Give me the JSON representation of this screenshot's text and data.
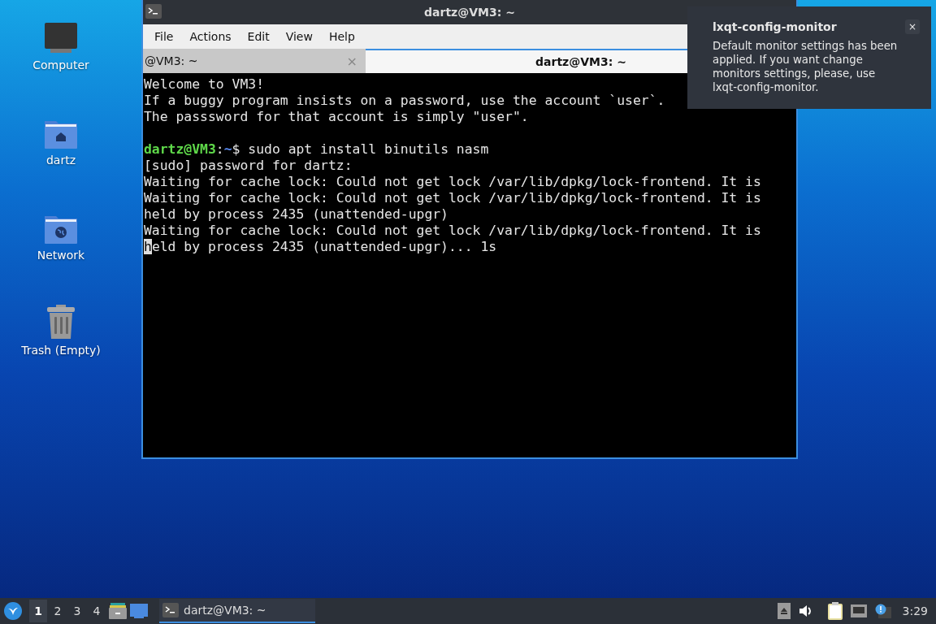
{
  "desktop_icons": [
    {
      "kind": "computer",
      "label": "Computer"
    },
    {
      "kind": "home",
      "label": "dartz"
    },
    {
      "kind": "network",
      "label": "Network"
    },
    {
      "kind": "trash",
      "label": "Trash (Empty)"
    }
  ],
  "window": {
    "title": "dartz@VM3: ~",
    "menu": [
      "File",
      "Actions",
      "Edit",
      "View",
      "Help"
    ],
    "tabs": [
      {
        "label": "@VM3: ~",
        "selected": false,
        "close": "×"
      },
      {
        "label": "dartz@VM3: ~",
        "selected": true
      }
    ],
    "lines": [
      {
        "kind": "output",
        "text": "Welcome to VM3!"
      },
      {
        "kind": "output",
        "text": "If a buggy program insists on a password, use the account `user`."
      },
      {
        "kind": "output",
        "text": "The passsword for that account is simply \"user\"."
      },
      {
        "kind": "blank"
      },
      {
        "kind": "prompt",
        "user": "dartz@VM3",
        "sep": ":",
        "path": "~",
        "command": "$ sudo apt install binutils nasm"
      },
      {
        "kind": "output",
        "text": "[sudo] password for dartz:"
      },
      {
        "kind": "output",
        "text": "Waiting for cache lock: Could not get lock /var/lib/dpkg/lock-frontend. It is"
      },
      {
        "kind": "output",
        "text": "Waiting for cache lock: Could not get lock /var/lib/dpkg/lock-frontend. It is"
      },
      {
        "kind": "output",
        "text": "held by process 2435 (unattended-upgr)"
      },
      {
        "kind": "output",
        "text": "Waiting for cache lock: Could not get lock /var/lib/dpkg/lock-frontend. It is"
      },
      {
        "kind": "cursor",
        "cursor": "h",
        "text": "eld by process 2435 (unattended-upgr)... 1s"
      }
    ]
  },
  "notification": {
    "title": "lxqt-config-monitor",
    "body": "Default monitor settings has been applied. If you want change monitors settings, please, use lxqt-config-monitor.",
    "close": "×"
  },
  "taskbar": {
    "desktops": [
      {
        "label": "1",
        "selected": true
      },
      {
        "label": "2",
        "selected": false
      },
      {
        "label": "3",
        "selected": false
      },
      {
        "label": "4",
        "selected": false
      }
    ],
    "tasks": [
      {
        "label": "dartz@VM3: ~",
        "selected": true
      }
    ],
    "clock": "3:29"
  }
}
